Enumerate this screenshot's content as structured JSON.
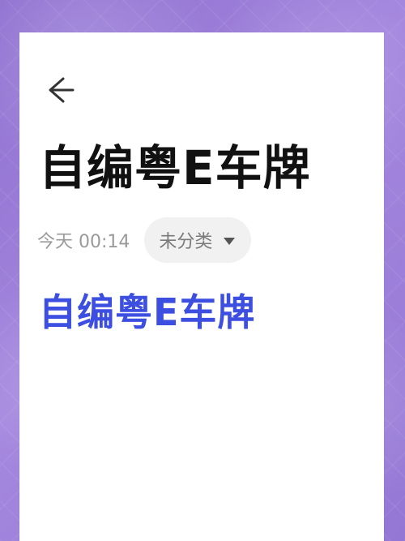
{
  "note": {
    "title": "自编粤E车牌",
    "date": "今天 00:14",
    "category": "未分类",
    "content": "自编粤E车牌"
  },
  "icons": {
    "back": "back-arrow-icon",
    "dropdown": "chevron-down-icon"
  },
  "colors": {
    "background": "#9c7fd6",
    "title": "#111111",
    "meta": "#9a9a9a",
    "chip_bg": "#f1f1f1",
    "accent": "#3d4fe0"
  }
}
